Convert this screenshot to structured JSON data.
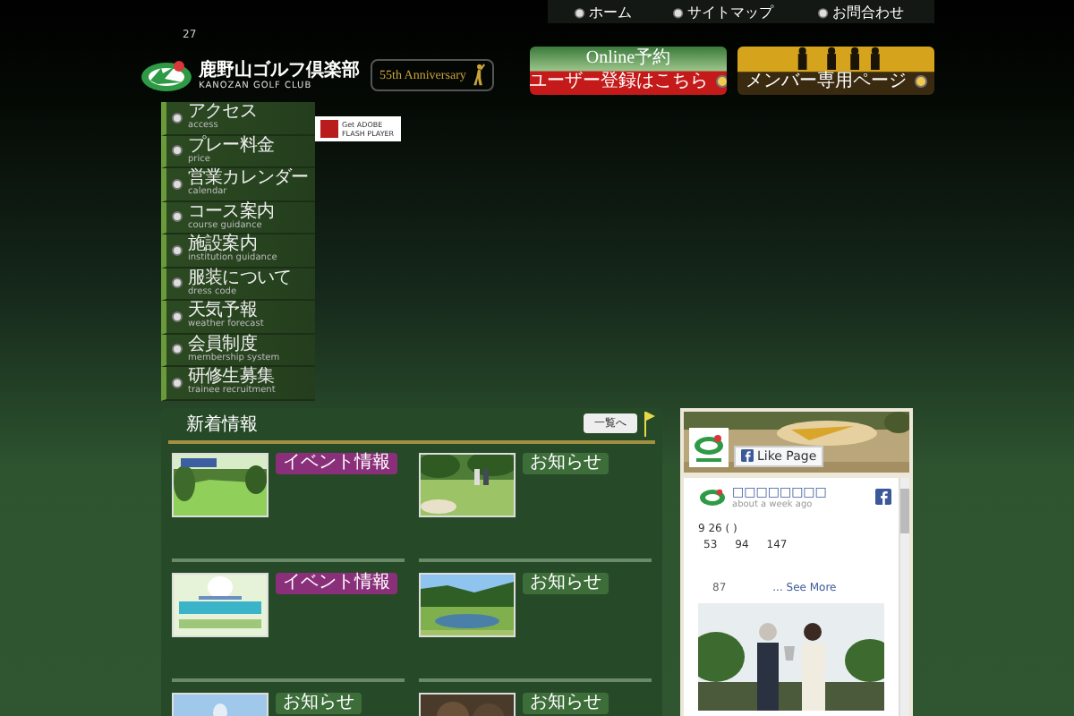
{
  "date": "27",
  "logo": {
    "name": "鹿野山ゴルフ倶楽部",
    "sub": "KANOZAN GOLF CLUB"
  },
  "anniversary": "55th Anniversary",
  "top_nav": [
    {
      "label": "ホーム"
    },
    {
      "label": "サイトマップ"
    },
    {
      "label": "お問合わせ"
    }
  ],
  "banners": [
    {
      "kind": "online",
      "title": "Online予約",
      "label": "ユーザー登録はこちら"
    },
    {
      "kind": "member",
      "label": "メンバー専用ページ"
    }
  ],
  "menu": [
    {
      "label": "アクセス",
      "sub": "access"
    },
    {
      "label": "プレー料金",
      "sub": "price"
    },
    {
      "label": "営業カレンダー",
      "sub": "calendar"
    },
    {
      "label": "コース案内",
      "sub": "course guidance"
    },
    {
      "label": "施設案内",
      "sub": "institution guidance"
    },
    {
      "label": "服装について",
      "sub": "dress code"
    },
    {
      "label": "天気予報",
      "sub": "weather forecast"
    },
    {
      "label": "会員制度",
      "sub": "membership system"
    },
    {
      "label": "研修生募集",
      "sub": "trainee recruitment"
    }
  ],
  "flash_badge": "Get ADOBE FLASH PLAYER",
  "news": {
    "title": "新着情報",
    "more": "一覧へ",
    "items": [
      {
        "kind": "event",
        "tag": "イベント情報"
      },
      {
        "kind": "notice",
        "tag": "お知らせ"
      },
      {
        "kind": "event",
        "tag": "イベント情報"
      },
      {
        "kind": "notice",
        "tag": "お知らせ"
      },
      {
        "kind": "notice",
        "tag": "お知らせ"
      },
      {
        "kind": "notice",
        "tag": "お知らせ"
      }
    ]
  },
  "facebook": {
    "like": "Like Page",
    "page_name": "□□□□□□□□",
    "time": "about a week ago",
    "date_line": "9 26 ( )",
    "numbers": [
      "53",
      "94",
      "147"
    ],
    "count": "87",
    "see_more": "... See More"
  }
}
